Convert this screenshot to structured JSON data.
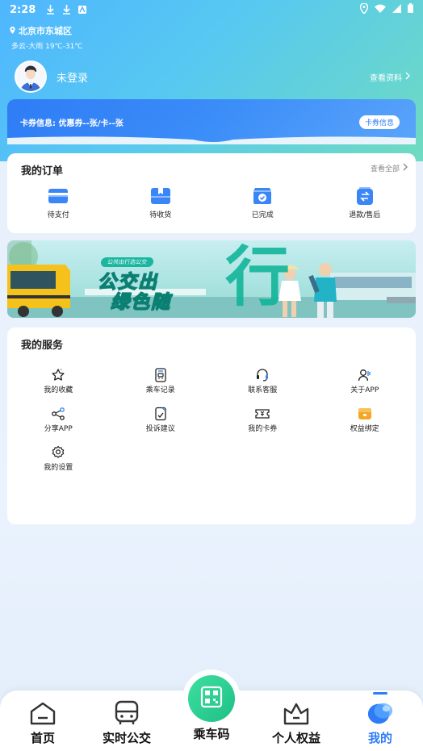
{
  "status_bar": {
    "time": "2:28"
  },
  "location": {
    "city": "北京市东城区",
    "weather": "多云-大雨 19℃-31℃"
  },
  "user": {
    "name": "未登录",
    "profile_link": "查看资料"
  },
  "card_banner": {
    "info": "卡券信息: 优惠券--张/卡--张",
    "button": "卡券信息"
  },
  "orders": {
    "title": "我的订单",
    "view_all": "查看全部",
    "items": [
      {
        "label": "待支付",
        "icon": "wallet-icon"
      },
      {
        "label": "待收货",
        "icon": "gift-box-icon"
      },
      {
        "label": "已完成",
        "icon": "check-bag-icon"
      },
      {
        "label": "退款/售后",
        "icon": "refund-icon"
      }
    ]
  },
  "promo": {
    "tag": "公共出行选公交",
    "line1": "公交出",
    "line2": "绿色随",
    "big_char": "行"
  },
  "services": {
    "title": "我的服务",
    "items": [
      {
        "label": "我的收藏",
        "icon": "star-icon"
      },
      {
        "label": "乘车记录",
        "icon": "bus-record-icon"
      },
      {
        "label": "联系客服",
        "icon": "headset-icon"
      },
      {
        "label": "关于APP",
        "icon": "user-info-icon"
      },
      {
        "label": "分享APP",
        "icon": "share-icon"
      },
      {
        "label": "投诉建议",
        "icon": "feedback-icon"
      },
      {
        "label": "我的卡券",
        "icon": "coupon-icon"
      },
      {
        "label": "权益绑定",
        "icon": "benefit-icon"
      },
      {
        "label": "我的设置",
        "icon": "gear-icon"
      }
    ]
  },
  "tabbar": {
    "items": [
      {
        "label": "首页",
        "icon": "home-icon"
      },
      {
        "label": "实时公交",
        "icon": "bus-icon"
      },
      {
        "label": "乘车码",
        "icon": "qr-code-icon"
      },
      {
        "label": "个人权益",
        "icon": "crown-icon"
      },
      {
        "label": "我的",
        "icon": "profile-blob-icon"
      }
    ],
    "active": "我的"
  },
  "colors": {
    "accent": "#2f7cf6",
    "green": "#1dbf86",
    "header_start": "#4fb6ff",
    "header_end": "#6fdbc0"
  }
}
